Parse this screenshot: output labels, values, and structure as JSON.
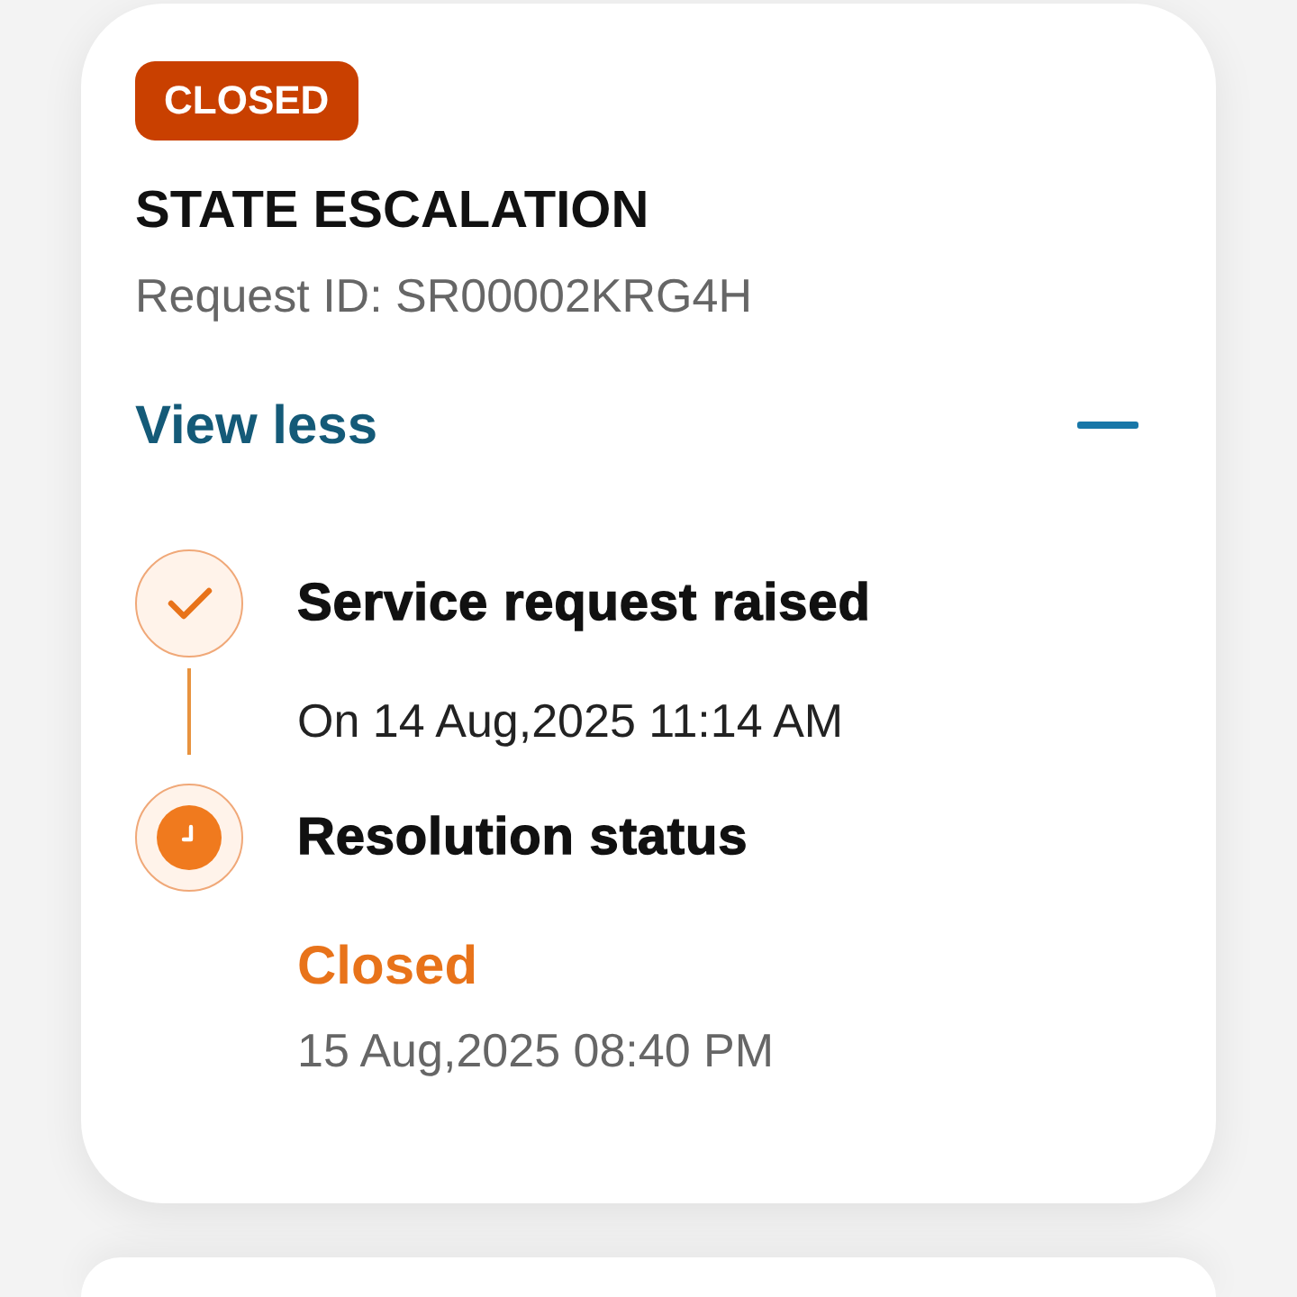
{
  "request": {
    "status_badge": "CLOSED",
    "title": "STATE ESCALATION",
    "request_id": "Request ID: SR00002KRG4H",
    "toggle": {
      "label": "View less",
      "expanded": true
    }
  },
  "timeline": [
    {
      "kind": "completed",
      "title": "Service request raised",
      "details": [
        {
          "kind": "date",
          "text": "On 14 Aug,2025 11:14 AM"
        }
      ]
    },
    {
      "kind": "current",
      "title": "Resolution status",
      "details": [
        {
          "kind": "status",
          "text": "Closed"
        },
        {
          "kind": "timestamp",
          "text": "15 Aug,2025 08:40 PM"
        }
      ]
    }
  ]
}
